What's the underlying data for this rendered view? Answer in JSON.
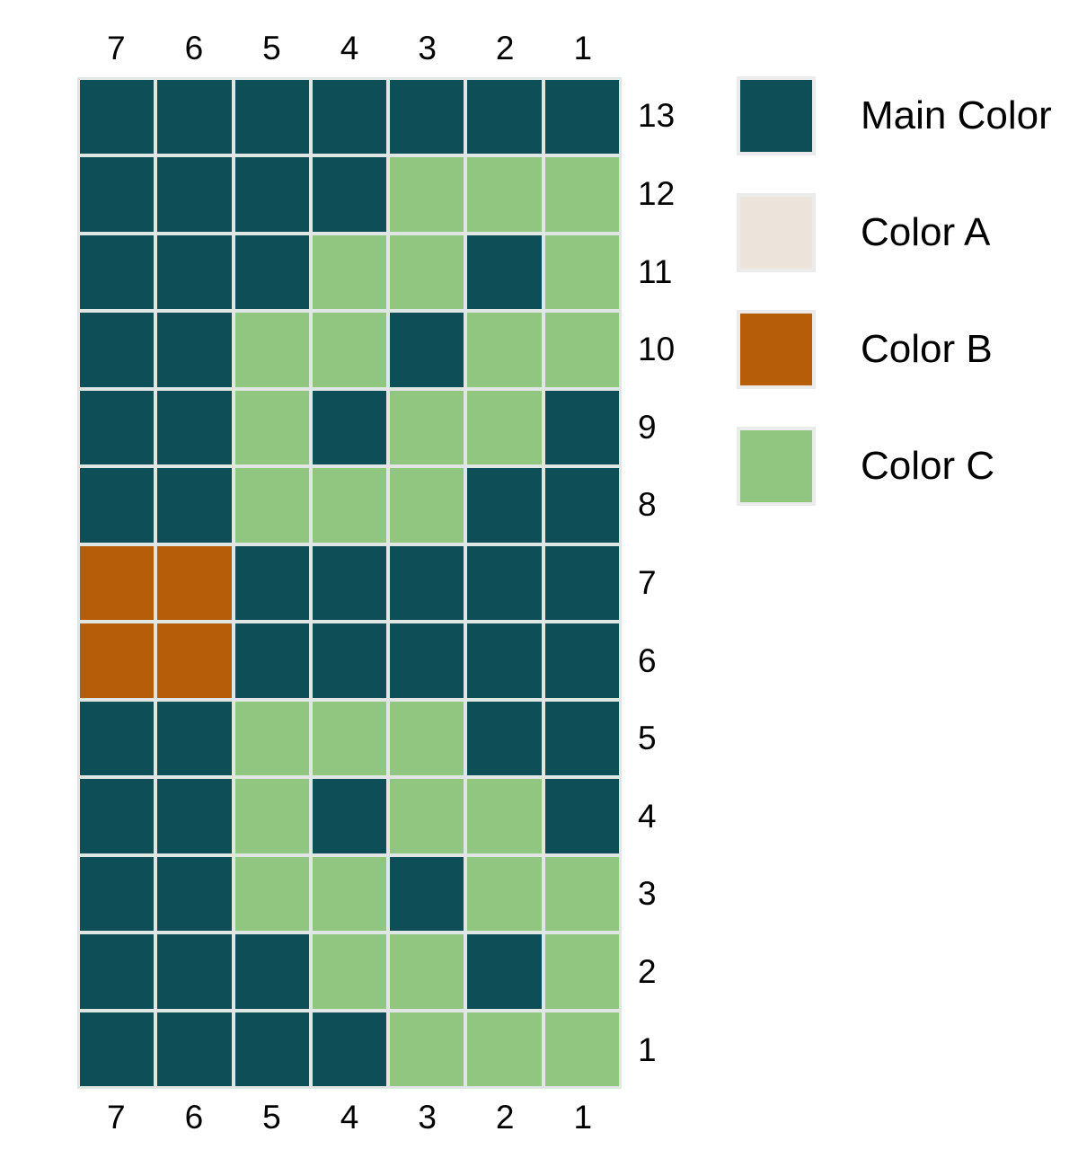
{
  "chart_data": {
    "type": "heatmap",
    "title": "",
    "xlabel": "",
    "ylabel": "",
    "grid": true,
    "legend_position": "right",
    "x_top_ticks": [
      "7",
      "6",
      "5",
      "4",
      "3",
      "2",
      "1"
    ],
    "x_bottom_ticks": [
      "7",
      "6",
      "5",
      "4",
      "3",
      "2",
      "1"
    ],
    "y_ticks": [
      "13",
      "12",
      "11",
      "10",
      "9",
      "8",
      "7",
      "6",
      "5",
      "4",
      "3",
      "2",
      "1"
    ],
    "categories": [
      "Main Color",
      "Color A",
      "Color B",
      "Color C"
    ],
    "category_colors": {
      "Main Color": "#0e4e57",
      "Color A": "#ece3da",
      "Color B": "#b55d09",
      "Color C": "#90c67f"
    },
    "cell_color_keys": [
      [
        "Main Color",
        "Main Color",
        "Main Color",
        "Main Color",
        "Main Color",
        "Main Color",
        "Main Color"
      ],
      [
        "Main Color",
        "Main Color",
        "Main Color",
        "Main Color",
        "Color C",
        "Color C",
        "Color C"
      ],
      [
        "Main Color",
        "Main Color",
        "Main Color",
        "Color C",
        "Color C",
        "Main Color",
        "Color C"
      ],
      [
        "Main Color",
        "Main Color",
        "Color C",
        "Color C",
        "Main Color",
        "Color C",
        "Color C"
      ],
      [
        "Main Color",
        "Main Color",
        "Color C",
        "Main Color",
        "Color C",
        "Color C",
        "Main Color"
      ],
      [
        "Main Color",
        "Main Color",
        "Color C",
        "Color C",
        "Color C",
        "Main Color",
        "Main Color"
      ],
      [
        "Color B",
        "Color B",
        "Main Color",
        "Main Color",
        "Main Color",
        "Main Color",
        "Main Color"
      ],
      [
        "Color B",
        "Color B",
        "Main Color",
        "Main Color",
        "Main Color",
        "Main Color",
        "Main Color"
      ],
      [
        "Main Color",
        "Main Color",
        "Color C",
        "Color C",
        "Color C",
        "Main Color",
        "Main Color"
      ],
      [
        "Main Color",
        "Main Color",
        "Color C",
        "Main Color",
        "Color C",
        "Color C",
        "Main Color"
      ],
      [
        "Main Color",
        "Main Color",
        "Color C",
        "Color C",
        "Main Color",
        "Color C",
        "Color C"
      ],
      [
        "Main Color",
        "Main Color",
        "Main Color",
        "Color C",
        "Color C",
        "Main Color",
        "Color C"
      ],
      [
        "Main Color",
        "Main Color",
        "Main Color",
        "Main Color",
        "Color C",
        "Color C",
        "Color C"
      ]
    ],
    "row_order_top_to_bottom": [
      "13",
      "12",
      "11",
      "10",
      "9",
      "8",
      "7",
      "6",
      "5",
      "4",
      "3",
      "2",
      "1"
    ],
    "col_order_left_to_right": [
      "7",
      "6",
      "5",
      "4",
      "3",
      "2",
      "1"
    ],
    "grid_line_color": "#dfe6e4",
    "background_color": "#ffffff"
  },
  "legend": {
    "items": [
      {
        "label": "Main Color",
        "color": "#0e4e57"
      },
      {
        "label": "Color A",
        "color": "#ece3da"
      },
      {
        "label": "Color B",
        "color": "#b55d09"
      },
      {
        "label": "Color C",
        "color": "#90c67f"
      }
    ]
  }
}
